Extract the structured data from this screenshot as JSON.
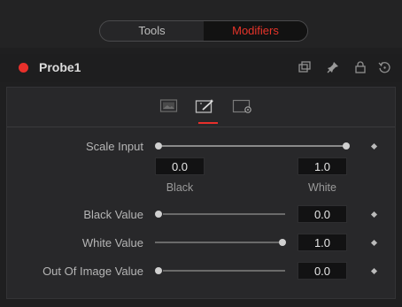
{
  "tabs": {
    "tools": "Tools",
    "modifiers": "Modifiers"
  },
  "node": {
    "name": "Probe1",
    "status_color": "#e8302b"
  },
  "header_icons": [
    "windows-icon",
    "pin-icon",
    "lock-icon",
    "reset-icon"
  ],
  "subtabs": [
    "image-tab-icon",
    "magic-wand-tab-icon",
    "settings-tab-icon"
  ],
  "active_subtab": "magic-wand-tab-icon",
  "controls": {
    "scale_input": {
      "label": "Scale Input",
      "low": "0.0",
      "high": "1.0",
      "low_label": "Black",
      "high_label": "White"
    },
    "black_value": {
      "label": "Black Value",
      "value": "0.0"
    },
    "white_value": {
      "label": "White Value",
      "value": "1.0"
    },
    "out_of_image": {
      "label": "Out Of Image Value",
      "value": "0.0"
    }
  },
  "accent_color": "#e6342a"
}
